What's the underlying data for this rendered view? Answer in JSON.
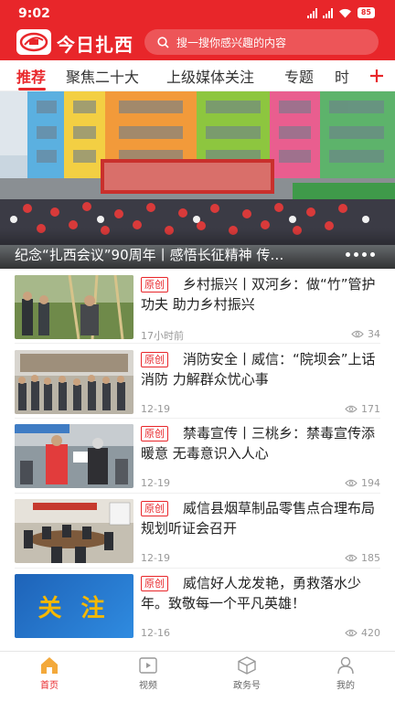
{
  "status": {
    "time": "9:02",
    "battery": "85"
  },
  "header": {
    "brand": "今日扎西",
    "search_placeholder": "搜一搜你感兴趣的内容"
  },
  "tabs": [
    {
      "label": "推荐",
      "active": true
    },
    {
      "label": "聚焦二十大",
      "active": false
    },
    {
      "label": "上级媒体关注",
      "active": false
    },
    {
      "label": "专题",
      "active": false
    },
    {
      "label": "时",
      "active": false
    }
  ],
  "hero": {
    "caption": "纪念“扎西会议”90周年丨感悟长征精神 传…"
  },
  "news": [
    {
      "badge": "原创",
      "title": "乡村振兴丨双河乡：做“竹”管护功夫 助力乡村振兴",
      "date": "17小时前",
      "views": "34"
    },
    {
      "badge": "原创",
      "title": "消防安全丨威信：“院坝会”上话消防 力解群众忧心事",
      "date": "12-19",
      "views": "171"
    },
    {
      "badge": "原创",
      "title": "禁毒宣传丨三桃乡：禁毒宣传添暖意 无毒意识入人心",
      "date": "12-19",
      "views": "194"
    },
    {
      "badge": "原创",
      "title": "威信县烟草制品零售点合理布局规划听证会召开",
      "date": "12-19",
      "views": "185"
    },
    {
      "badge": "原创",
      "title": "威信好人龙发艳，勇救落水少年。致敬每一个平凡英雄！",
      "date": "12-16",
      "views": "420",
      "thumb_text": "关 注"
    }
  ],
  "bottom_nav": [
    {
      "label": "首页",
      "icon": "home-icon",
      "active": true
    },
    {
      "label": "视频",
      "icon": "video-icon",
      "active": false
    },
    {
      "label": "政务号",
      "icon": "cube-icon",
      "active": false
    },
    {
      "label": "我的",
      "icon": "user-icon",
      "active": false
    }
  ],
  "colors": {
    "brand_red": "#e8262a",
    "text_gray": "#999999"
  }
}
